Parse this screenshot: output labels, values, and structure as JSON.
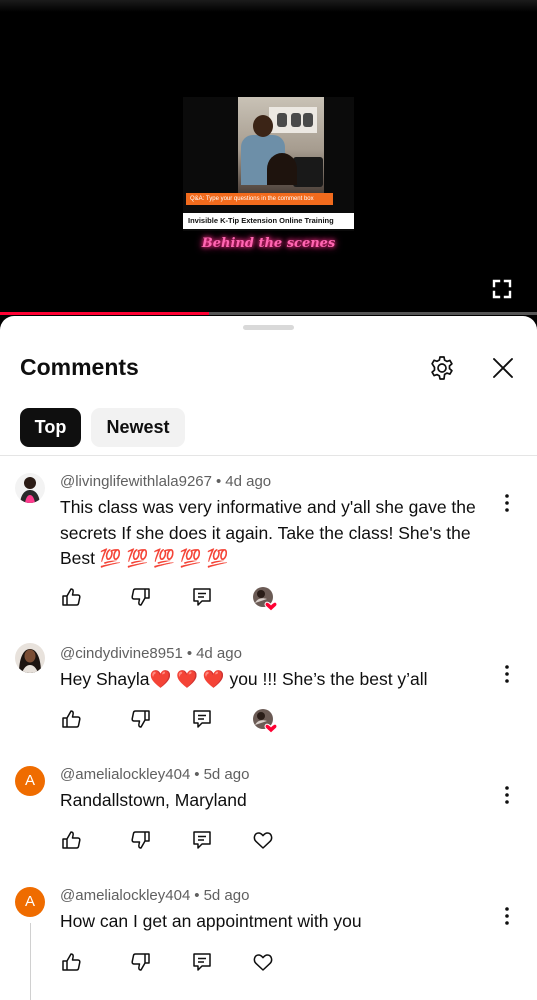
{
  "video": {
    "thumbnail_qa_text": "Q&A: Type your questions in the comment box",
    "thumbnail_title": "Invisible K-Tip Extension Online Training",
    "overlay_caption": "Behind the scenes",
    "progress_fraction": 0.39,
    "colors": {
      "progress": "#ff0033",
      "caption": "#ff66b2"
    }
  },
  "comments_panel": {
    "title": "Comments",
    "sort_chips": [
      {
        "label": "Top",
        "selected": true
      },
      {
        "label": "Newest",
        "selected": false
      }
    ],
    "icons": {
      "settings": "gear-icon",
      "close": "close-icon",
      "fullscreen": "fullscreen-icon"
    }
  },
  "comments": [
    {
      "author": "@livinglifewithlala9267",
      "age": "4d ago",
      "avatar_letter": "",
      "text": "This class was very informative and y'all she gave the secrets If she does it again. Take the class! She's the Best 💯 💯 💯 💯 💯",
      "creator_hearted": true
    },
    {
      "author": "@cindydivine8951",
      "age": "4d ago",
      "avatar_letter": "",
      "text": "Hey Shayla❤️ ❤️ ❤️  you !!! She’s the best y’all",
      "creator_hearted": true
    },
    {
      "author": "@amelialockley404",
      "age": "5d ago",
      "avatar_letter": "A",
      "text": "Randallstown, Maryland",
      "creator_hearted": false
    },
    {
      "author": "@amelialockley404",
      "age": "5d ago",
      "avatar_letter": "A",
      "text": "How can I get an appointment with you",
      "creator_hearted": false
    }
  ]
}
